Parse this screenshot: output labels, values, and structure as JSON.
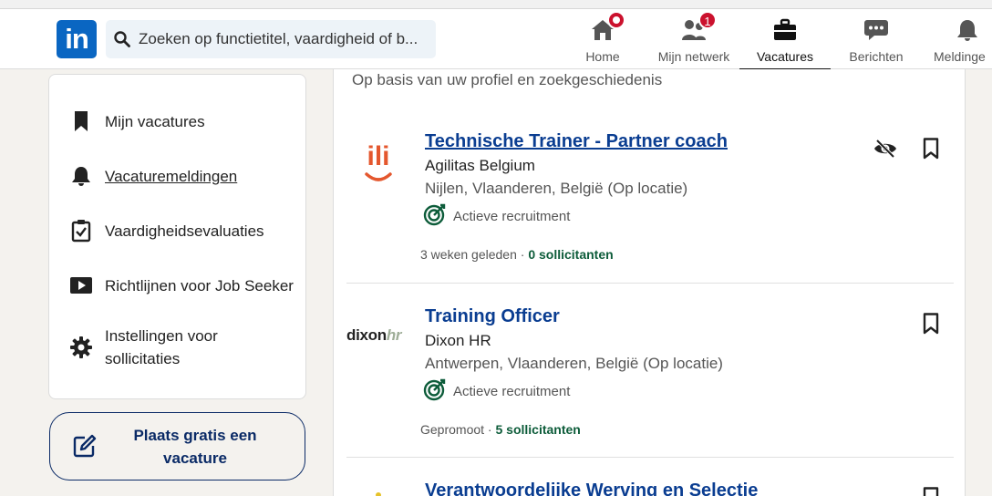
{
  "nav": {
    "logo_text": "in",
    "search_placeholder": "Zoeken op functietitel, vaardigheid of b...",
    "items": [
      {
        "label": "Home",
        "icon": "home-icon",
        "badge": ""
      },
      {
        "label": "Mijn netwerk",
        "icon": "network-icon",
        "badge": "1"
      },
      {
        "label": "Vacatures",
        "icon": "briefcase-icon",
        "badge": ""
      },
      {
        "label": "Berichten",
        "icon": "messaging-icon",
        "badge": ""
      },
      {
        "label": "Meldinge",
        "icon": "bell-icon",
        "badge": ""
      }
    ],
    "active": "Vacatures"
  },
  "sidebar": {
    "items": [
      {
        "label": "Mijn vacatures",
        "icon": "bookmark-icon"
      },
      {
        "label": "Vacaturemeldingen",
        "icon": "bell-icon"
      },
      {
        "label": "Vaardigheidsevaluaties",
        "icon": "clipboard-check-icon"
      },
      {
        "label": "Richtlijnen voor Job Seeker",
        "icon": "video-play-icon"
      },
      {
        "label": "Instellingen voor sollicitaties",
        "icon": "gear-icon"
      }
    ],
    "post_job_label": "Plaats gratis een vacature"
  },
  "main": {
    "subtitle": "Op basis van uw profiel en zoekgeschiedenis",
    "jobs": [
      {
        "title": "Technische Trainer - Partner coach",
        "company": "Agilitas Belgium",
        "location": "Nijlen, Vlaanderen, België (Op locatie)",
        "recruiting": "Actieve recruitment",
        "time": "3 weken geleden",
        "separator": " · ",
        "applicants": "0 sollicitanten",
        "logo_text": "ili"
      },
      {
        "title": "Training Officer",
        "company": "Dixon HR",
        "location": "Antwerpen, Vlaanderen, België (Op locatie)",
        "recruiting": "Actieve recruitment",
        "time": "Gepromoot",
        "separator": " · ",
        "applicants": "5 sollicitanten",
        "logo_text_a": "dixon",
        "logo_text_b": "hr"
      },
      {
        "title": "Verantwoordelijke Werving en Selectie"
      }
    ]
  },
  "colors": {
    "brand": "#0a66c2",
    "badge": "#cb112d",
    "link": "#0a3d91",
    "applicants": "#0d5c3a",
    "recruit_ring": "#0d5c3a",
    "agilitas_orange": "#e4572e"
  }
}
